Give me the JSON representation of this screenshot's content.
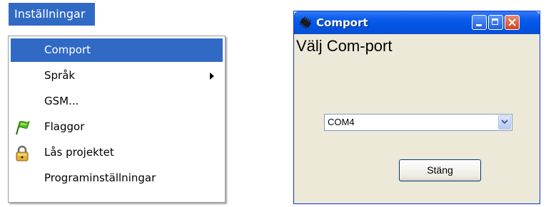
{
  "menu": {
    "title": "Inställningar",
    "items": [
      {
        "label": "Comport",
        "icon": null,
        "selected": true
      },
      {
        "label": "Språk",
        "icon": null,
        "submenu": true
      },
      {
        "label": "GSM...",
        "icon": null
      },
      {
        "label": "Flaggor",
        "icon": "flag-icon"
      },
      {
        "label": "Lås projektet",
        "icon": "lock-icon"
      },
      {
        "label": "Programinställningar",
        "icon": null
      }
    ]
  },
  "dialog": {
    "title": "Comport",
    "heading": "Välj Com-port",
    "combo_value": "COM4",
    "close_button_label": "Stäng"
  },
  "colors": {
    "menu_highlight": "#316ac5",
    "dialog_background": "#ece9d8",
    "titlebar_blue": "#0054e3",
    "close_red": "#d4401e"
  }
}
